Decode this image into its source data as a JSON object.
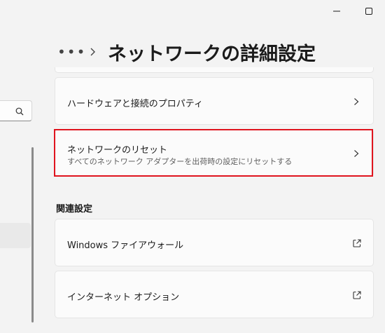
{
  "window": {
    "controls": [
      "minimize",
      "maximize"
    ]
  },
  "header": {
    "more": "•••",
    "title": "ネットワークの詳細設定"
  },
  "cards": {
    "hardware": {
      "label": "ハードウェアと接続のプロパティ"
    },
    "reset": {
      "label": "ネットワークのリセット",
      "description": "すべてのネットワーク アダプターを出荷時の設定にリセットする"
    }
  },
  "related": {
    "heading": "関連設定",
    "firewall": {
      "label": "Windows ファイアウォール"
    },
    "internet_options": {
      "label": "インターネット オプション"
    }
  },
  "colors": {
    "highlight": "#e0141e",
    "background": "#f3f3f3",
    "card": "#fbfbfb"
  }
}
